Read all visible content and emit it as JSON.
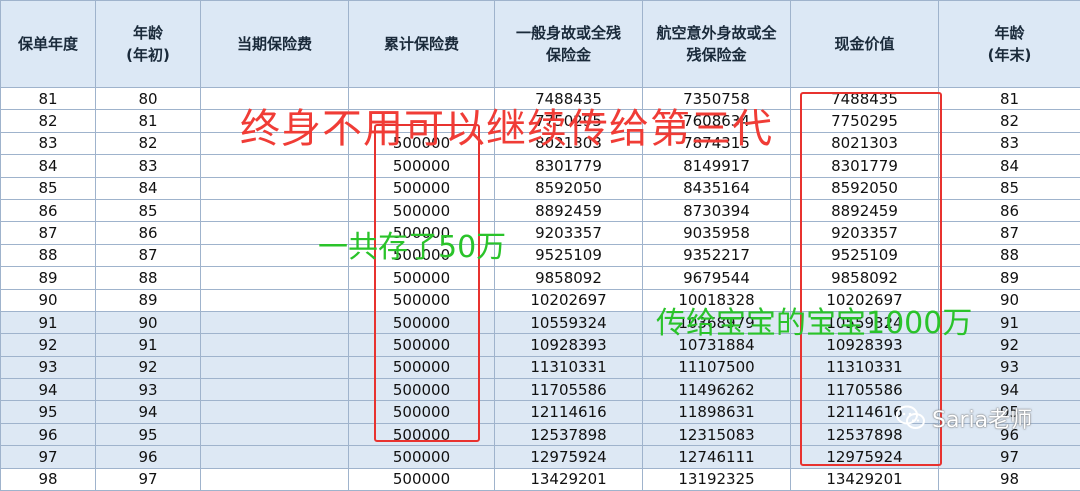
{
  "headers": [
    "保单年度",
    "年龄\n(年初)",
    "当期保险费",
    "累计保险费",
    "一般身故或全残保险金",
    "航空意外身故或全残保险金",
    "现金价值",
    "年龄\n(年末)"
  ],
  "rows": [
    [
      "81",
      "80",
      "",
      "",
      "7488435",
      "7350758",
      "7488435",
      "81"
    ],
    [
      "82",
      "81",
      "",
      "",
      "7750295",
      "7608634",
      "7750295",
      "82"
    ],
    [
      "83",
      "82",
      "",
      "500000",
      "8021303",
      "7874315",
      "8021303",
      "83"
    ],
    [
      "84",
      "83",
      "",
      "500000",
      "8301779",
      "8149917",
      "8301779",
      "84"
    ],
    [
      "85",
      "84",
      "",
      "500000",
      "8592050",
      "8435164",
      "8592050",
      "85"
    ],
    [
      "86",
      "85",
      "",
      "500000",
      "8892459",
      "8730394",
      "8892459",
      "86"
    ],
    [
      "87",
      "86",
      "",
      "500000",
      "9203357",
      "9035958",
      "9203357",
      "87"
    ],
    [
      "88",
      "87",
      "",
      "500000",
      "9525109",
      "9352217",
      "9525109",
      "88"
    ],
    [
      "89",
      "88",
      "",
      "500000",
      "9858092",
      "9679544",
      "9858092",
      "89"
    ],
    [
      "90",
      "89",
      "",
      "500000",
      "10202697",
      "10018328",
      "10202697",
      "90"
    ],
    [
      "91",
      "90",
      "",
      "500000",
      "10559324",
      "10368979",
      "10559324",
      "91"
    ],
    [
      "92",
      "91",
      "",
      "500000",
      "10928393",
      "10731884",
      "10928393",
      "92"
    ],
    [
      "93",
      "92",
      "",
      "500000",
      "11310331",
      "11107500",
      "11310331",
      "93"
    ],
    [
      "94",
      "93",
      "",
      "500000",
      "11705586",
      "11496262",
      "11705586",
      "94"
    ],
    [
      "95",
      "94",
      "",
      "500000",
      "12114616",
      "11898631",
      "12114616",
      "95"
    ],
    [
      "96",
      "95",
      "",
      "500000",
      "12537898",
      "12315083",
      "12537898",
      "96"
    ],
    [
      "97",
      "96",
      "",
      "500000",
      "12975924",
      "12746111",
      "12975924",
      "97"
    ],
    [
      "98",
      "97",
      "",
      "500000",
      "13429201",
      "13192325",
      "13429201",
      "98"
    ]
  ],
  "annotations": {
    "red": "终身不用可以继续传给第三代",
    "green1": "一共存了50万",
    "green2": "传给宝宝的宝宝1000万"
  },
  "watermark": {
    "text": "Saria老师"
  },
  "colors": {
    "header_bg": "#dce8f5",
    "shaded_row": "#dde8f4",
    "annotation_red": "#f03c36",
    "annotation_green": "#2ac32a",
    "box_red": "#e8322f"
  }
}
